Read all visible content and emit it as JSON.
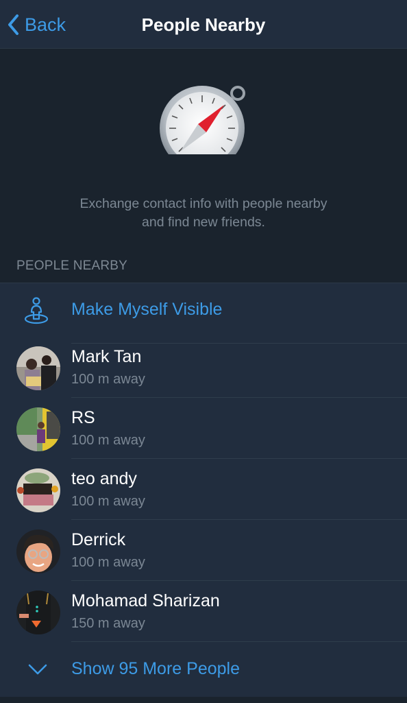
{
  "navbar": {
    "back_label": "Back",
    "title": "People Nearby"
  },
  "hero": {
    "icon": "compass-icon",
    "description_line1": "Exchange contact info with people nearby",
    "description_line2": "and find new friends."
  },
  "section": {
    "header": "PEOPLE NEARBY",
    "make_visible_label": "Make Myself Visible",
    "people": [
      {
        "name": "Mark Tan",
        "distance": "100 m away"
      },
      {
        "name": "RS",
        "distance": "100 m away"
      },
      {
        "name": "teo andy",
        "distance": "100 m away"
      },
      {
        "name": "Derrick",
        "distance": "100 m away"
      },
      {
        "name": "Mohamad Sharizan",
        "distance": "150 m away"
      }
    ],
    "show_more_label": "Show 95 More People"
  },
  "colors": {
    "accent": "#3d9be6",
    "background": "#1a232d",
    "card": "#212d3e"
  }
}
